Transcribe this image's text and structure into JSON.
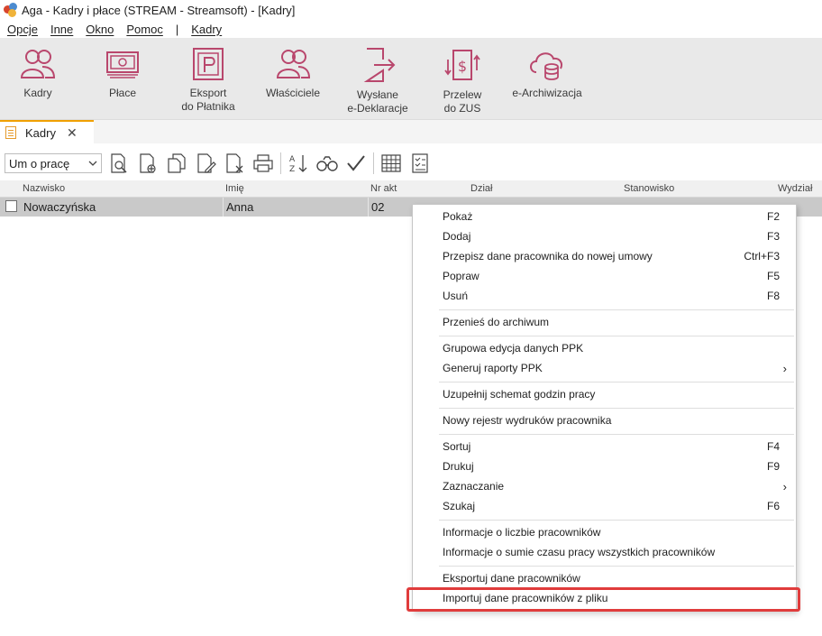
{
  "window": {
    "title": "Aga - Kadry i płace (STREAM - Streamsoft) - [Kadry]"
  },
  "menubar": {
    "items": [
      "Opcje",
      "Inne",
      "Okno",
      "Pomoc"
    ],
    "separator": "|",
    "extra": "Kadry"
  },
  "ribbon": {
    "buttons": [
      {
        "label": "Kadry",
        "icon": "people-icon"
      },
      {
        "label": "Płace",
        "icon": "money-icon"
      },
      {
        "label": "Eksport\ndo Płatnika",
        "icon": "platnik-p-icon"
      },
      {
        "label": "Właściciele",
        "icon": "owners-icon"
      },
      {
        "label": "Wysłane\ne-Deklaracje",
        "icon": "export-document-icon"
      },
      {
        "label": "Przelew\ndo ZUS",
        "icon": "transfer-icon"
      },
      {
        "label": "e-Archiwizacja",
        "icon": "cloud-archive-icon"
      }
    ]
  },
  "tab": {
    "label": "Kadry",
    "close": "✕"
  },
  "toolbar": {
    "combo_value": "Um o pracę"
  },
  "grid": {
    "columns": [
      "Nazwisko",
      "Imię",
      "Nr akt",
      "Dział",
      "Stanowisko",
      "Wydział"
    ],
    "rows": [
      {
        "nazwisko": "Nowaczyńska",
        "imie": "Anna",
        "nr_akt": "02"
      }
    ]
  },
  "context_menu": {
    "items": [
      {
        "label": "Pokaż",
        "shortcut": "F2"
      },
      {
        "label": "Dodaj",
        "shortcut": "F3"
      },
      {
        "label": "Przepisz dane pracownika do nowej umowy",
        "shortcut": "Ctrl+F3"
      },
      {
        "label": "Popraw",
        "shortcut": "F5"
      },
      {
        "label": "Usuń",
        "shortcut": "F8"
      },
      {
        "label": "Przenieś do archiwum",
        "shortcut": ""
      },
      {
        "label": "Grupowa edycja danych PPK",
        "shortcut": ""
      },
      {
        "label": "Generuj raporty PPK",
        "shortcut": "",
        "submenu": "›"
      },
      {
        "label": "Uzupełnij schemat godzin pracy",
        "shortcut": ""
      },
      {
        "label": "Nowy rejestr wydruków pracownika",
        "shortcut": ""
      },
      {
        "label": "Sortuj",
        "shortcut": "F4"
      },
      {
        "label": "Drukuj",
        "shortcut": "F9"
      },
      {
        "label": "Zaznaczanie",
        "shortcut": "",
        "submenu": "›"
      },
      {
        "label": "Szukaj",
        "shortcut": "F6"
      },
      {
        "label": "Informacje o liczbie pracowników",
        "shortcut": ""
      },
      {
        "label": "Informacje o sumie czasu pracy wszystkich pracowników",
        "shortcut": ""
      },
      {
        "label": "Eksportuj dane pracowników",
        "shortcut": ""
      },
      {
        "label": "Importuj dane pracowników z pliku",
        "shortcut": ""
      }
    ],
    "highlight_color": "#e03c3c"
  }
}
